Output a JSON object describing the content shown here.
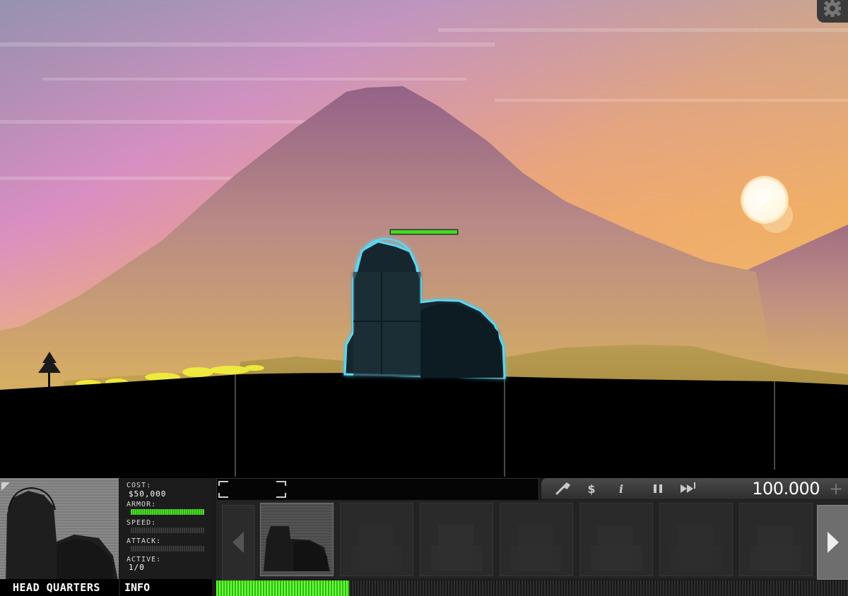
{
  "selected_unit": {
    "name": "HEAD QUARTERS",
    "cost_label": "COST:",
    "cost": "$50,000",
    "armor_label": "ARMOR:",
    "armor": 1.0,
    "speed_label": "SPEED:",
    "speed": 0.0,
    "attack_label": "ATTACK:",
    "attack": 0.0,
    "active_label": "ACTIVE:",
    "active": "1/0"
  },
  "info_tab": "INFO",
  "toolbar": {
    "money": "100.000",
    "icons": [
      "wrench-icon",
      "dollar-icon",
      "info-icon",
      "pause-icon",
      "fast-forward-icon",
      "plus-icon"
    ]
  },
  "build_slots": {
    "count": 7,
    "selected_index": 0
  },
  "build_progress": 0.21,
  "hq_health": 1.0,
  "colors": {
    "sky_top": "#8f7fa6",
    "sky_pink": "#d98fc0",
    "sky_orange": "#f2b347",
    "mountain": "#9a6a86",
    "ground": "#000000",
    "health_green": "#4bd62a",
    "hq_glow": "#5fd6f2",
    "hq_body": "#16262d"
  }
}
